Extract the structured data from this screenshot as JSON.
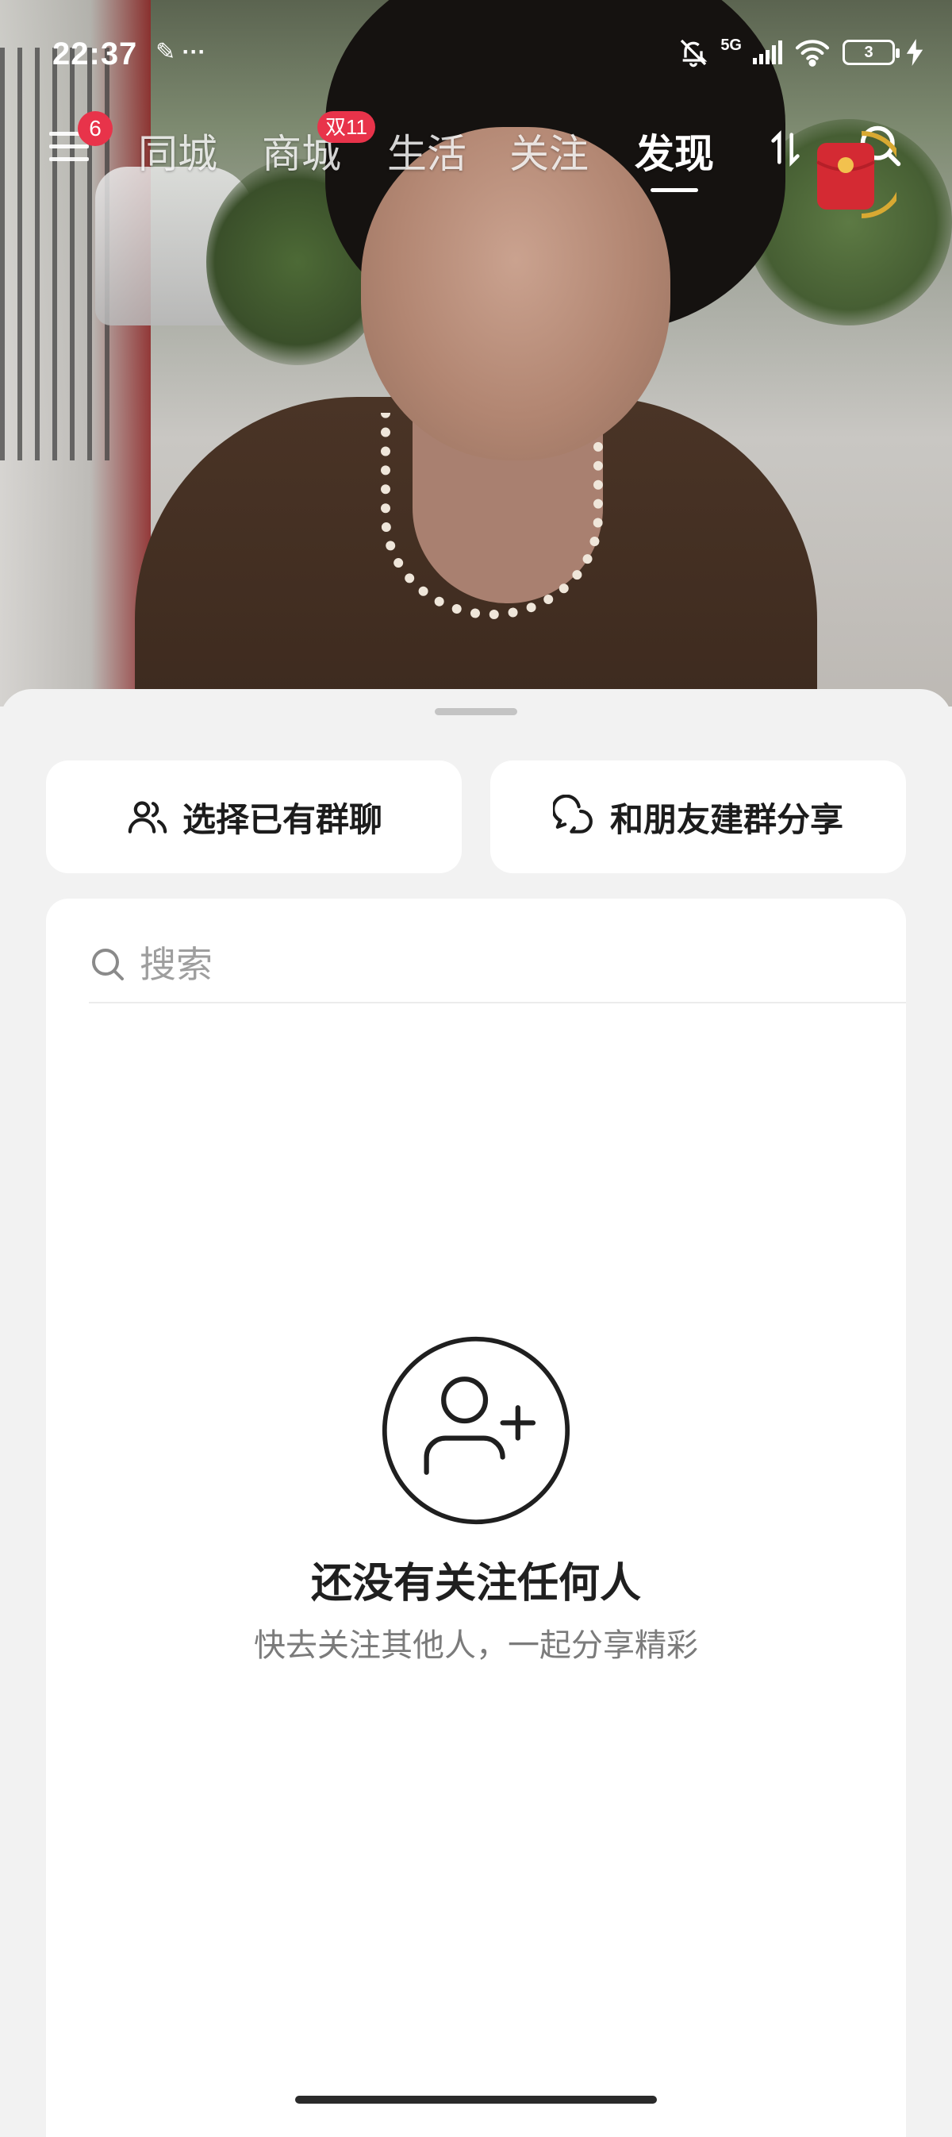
{
  "status_bar": {
    "time": "22:37",
    "left_extra": "✎ ···",
    "network": "5G",
    "battery": "3",
    "icons": [
      "wrench-icon",
      "more-dots-icon",
      "mute-bell-icon",
      "signal-icon",
      "wifi-icon",
      "battery-icon",
      "charging-icon"
    ]
  },
  "top_nav": {
    "menu_badge": "6",
    "tabs": [
      {
        "label": "同城",
        "active": false
      },
      {
        "label": "商城",
        "active": false,
        "badge": "双11"
      },
      {
        "label": "生活",
        "active": false
      },
      {
        "label": "关注",
        "active": false
      },
      {
        "label": "发现",
        "active": true
      }
    ]
  },
  "sheet": {
    "buttons": [
      {
        "label": "选择已有群聊",
        "icon": "group-users-icon"
      },
      {
        "label": "和朋友建群分享",
        "icon": "chat-bubbles-icon"
      }
    ],
    "search": {
      "placeholder": "搜索",
      "value": ""
    },
    "empty_state": {
      "title": "还没有关注任何人",
      "subtitle": "快去关注其他人，一起分享精彩",
      "icon": "add-person-icon"
    }
  },
  "colors": {
    "accent_badge": "#e8334a",
    "sheet_bg": "#f2f2f2",
    "card_bg": "#ffffff",
    "text_primary": "#1c1c1c",
    "text_secondary": "#7b7b7b"
  }
}
